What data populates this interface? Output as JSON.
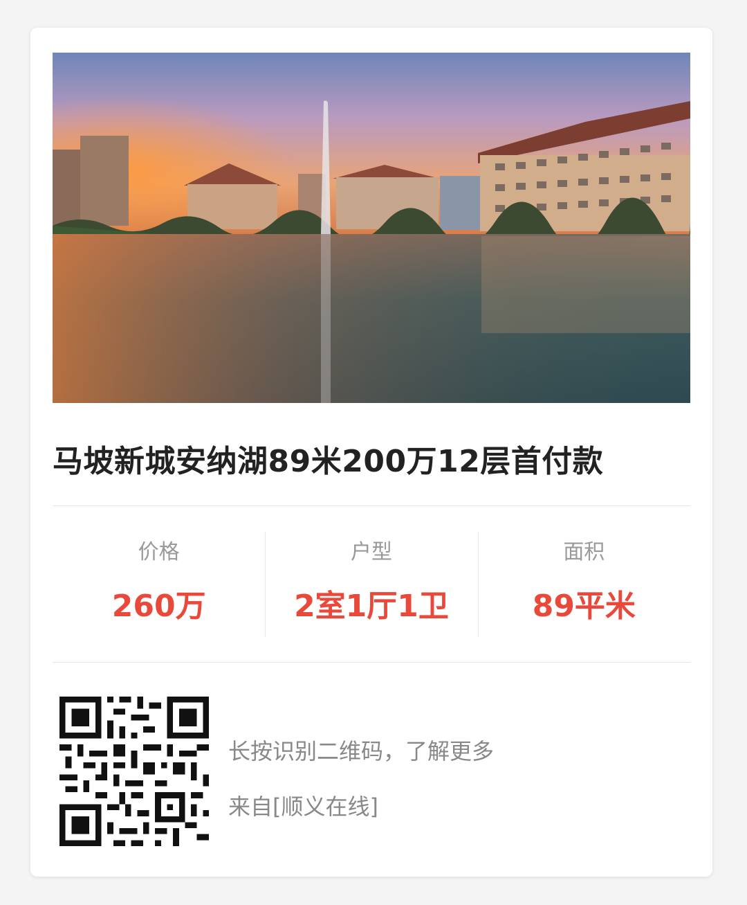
{
  "listing": {
    "title": "马坡新城安纳湖89米200万12层首付款",
    "photo_icon": "lakeside-residential-photo"
  },
  "stats": [
    {
      "label": "价格",
      "value": "260万"
    },
    {
      "label": "户型",
      "value": "2室1厅1卫"
    },
    {
      "label": "面积",
      "value": "89平米"
    }
  ],
  "footer": {
    "hint": "长按识别二维码，了解更多",
    "source": "来自[顺义在线]",
    "qr_icon": "qr-code"
  },
  "colors": {
    "accent": "#e8493a",
    "title": "#222222",
    "muted": "#999999"
  }
}
